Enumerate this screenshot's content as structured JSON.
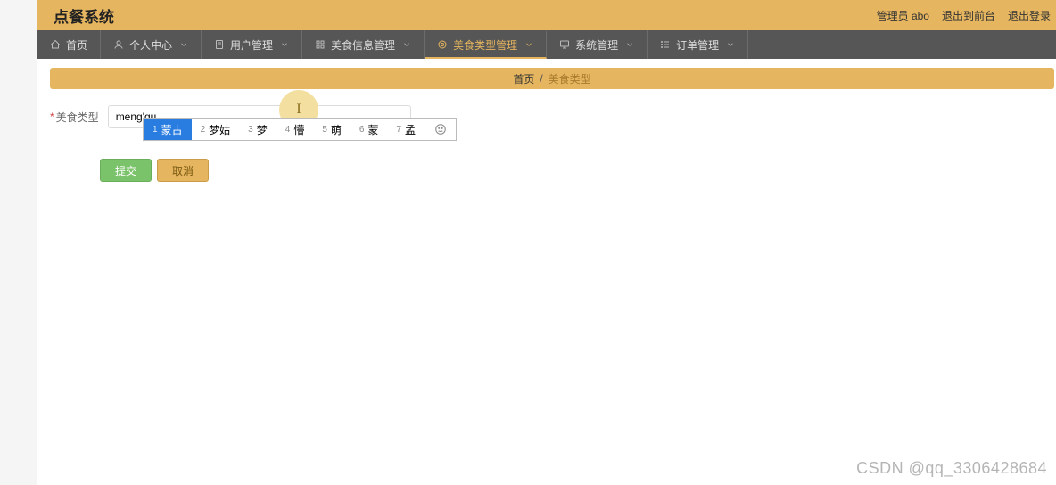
{
  "header": {
    "title": "点餐系统",
    "right": {
      "admin_label": "管理员 abo",
      "exit_front": "退出到前台",
      "exit_login": "退出登录"
    }
  },
  "nav": {
    "items": [
      {
        "label": "首页",
        "icon": "home",
        "has_chevron": false
      },
      {
        "label": "个人中心",
        "icon": "user",
        "has_chevron": true
      },
      {
        "label": "用户管理",
        "icon": "doc",
        "has_chevron": true
      },
      {
        "label": "美食信息管理",
        "icon": "grid",
        "has_chevron": true
      },
      {
        "label": "美食类型管理",
        "icon": "target",
        "has_chevron": true,
        "active": true
      },
      {
        "label": "系统管理",
        "icon": "monitor",
        "has_chevron": true
      },
      {
        "label": "订单管理",
        "icon": "list",
        "has_chevron": true
      }
    ]
  },
  "breadcrumb": {
    "home": "首页",
    "sep": "/",
    "current": "美食类型"
  },
  "form": {
    "label": "美食类型",
    "value": "meng'gu",
    "placeholder": ""
  },
  "ime": {
    "options": [
      {
        "n": "1",
        "text": "蒙古",
        "selected": true
      },
      {
        "n": "2",
        "text": "梦姑"
      },
      {
        "n": "3",
        "text": "梦"
      },
      {
        "n": "4",
        "text": "懵"
      },
      {
        "n": "5",
        "text": "萌"
      },
      {
        "n": "6",
        "text": "蒙"
      },
      {
        "n": "7",
        "text": "孟"
      }
    ]
  },
  "buttons": {
    "submit": "提交",
    "cancel": "取消"
  },
  "caret_glyph": "I",
  "watermark": "CSDN @qq_3306428684"
}
